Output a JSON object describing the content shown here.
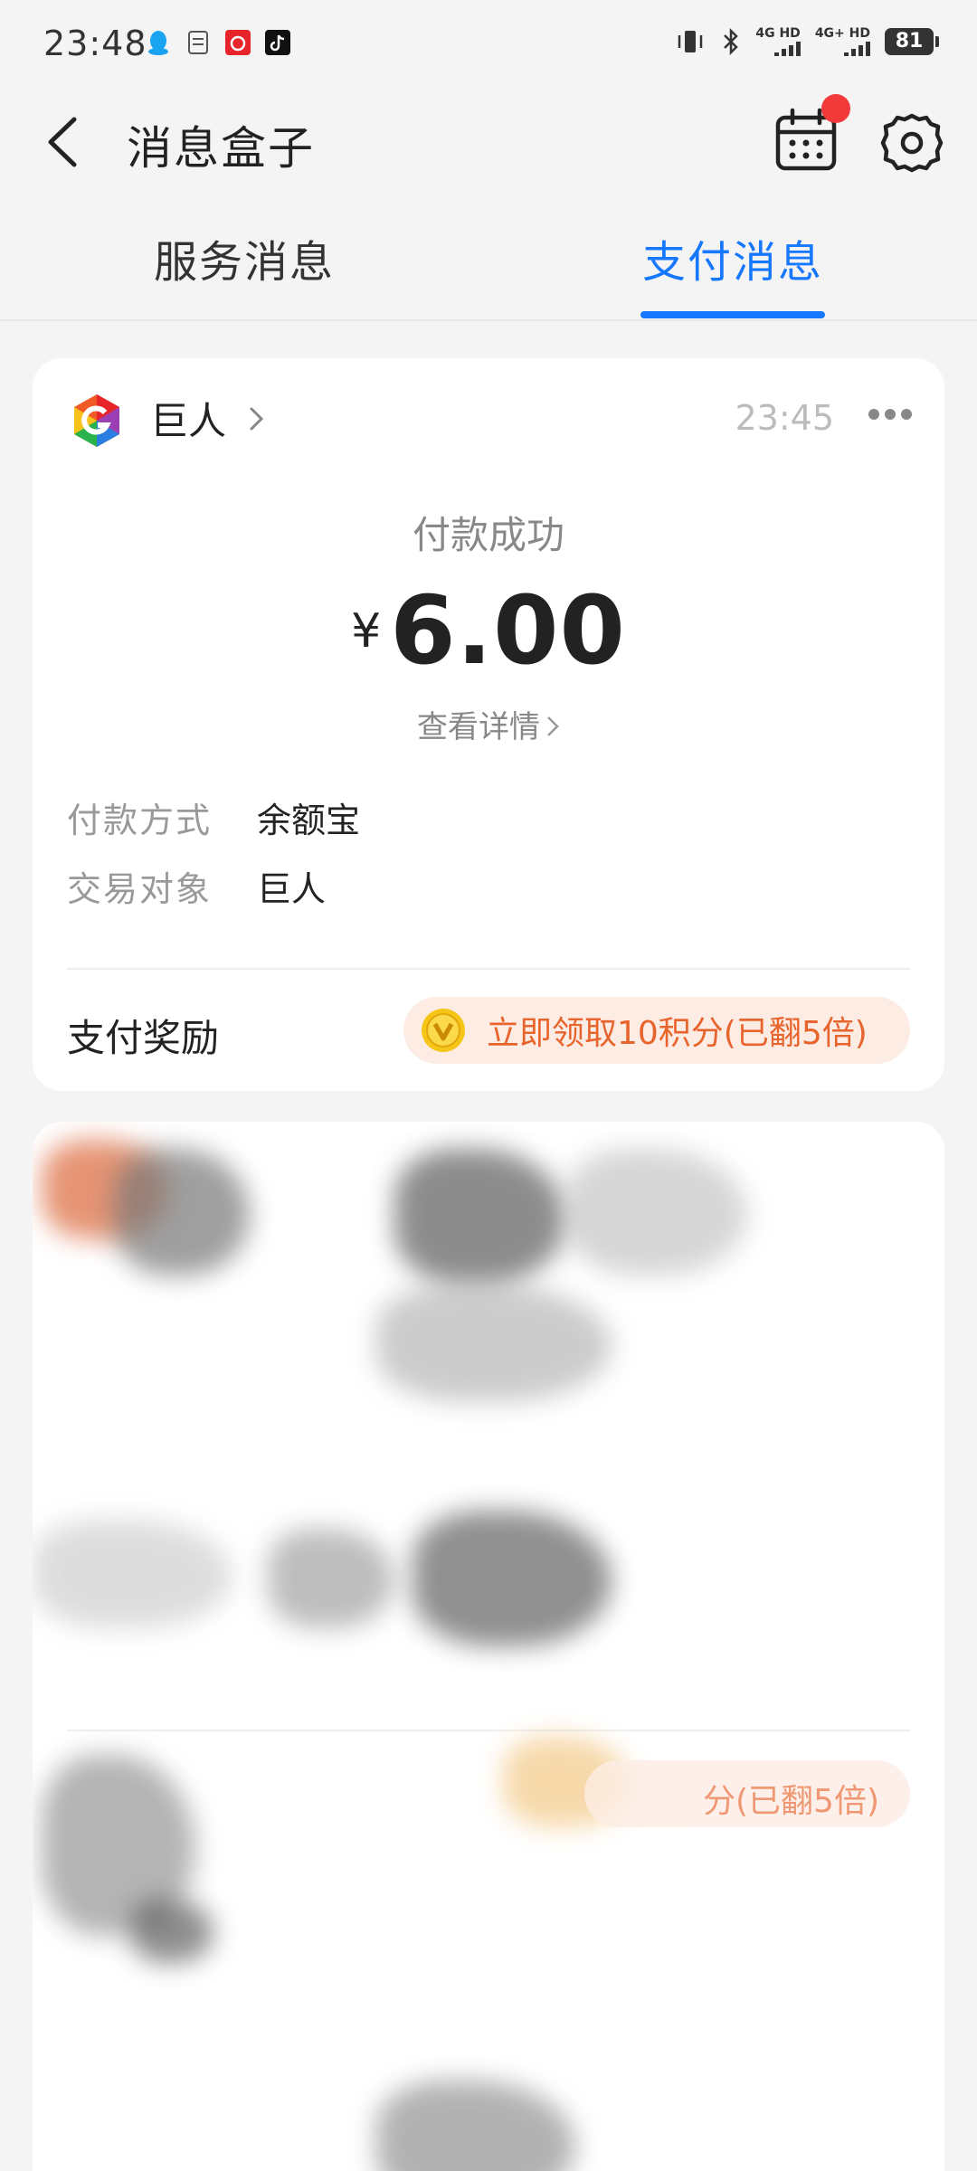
{
  "status_bar": {
    "time": "23:48",
    "app_icons": [
      "qq-icon",
      "notes-icon",
      "netease-music-icon",
      "tiktok-icon"
    ],
    "net1": "4G HD",
    "net2": "4G+ HD",
    "battery": "81"
  },
  "header": {
    "title": "消息盒子"
  },
  "tabs": [
    {
      "label": "服务消息",
      "active": false
    },
    {
      "label": "支付消息",
      "active": true
    }
  ],
  "card": {
    "merchant": "巨人",
    "time": "23:45",
    "status": "付款成功",
    "currency": "¥",
    "amount": "6.00",
    "details_link": "查看详情",
    "rows": [
      {
        "label": "付款方式",
        "value": "余额宝"
      },
      {
        "label": "交易对象",
        "value": "巨人"
      }
    ],
    "reward_label": "支付奖励",
    "reward_text": "立即领取10积分(已翻5倍)"
  },
  "obscured_card": {
    "reward_text_fragment": "分(已翻5倍)"
  },
  "colors": {
    "accent": "#1677ff",
    "reward": "#e8642d",
    "reward_bg": "#fdece4",
    "badge": "#f23a3a"
  }
}
